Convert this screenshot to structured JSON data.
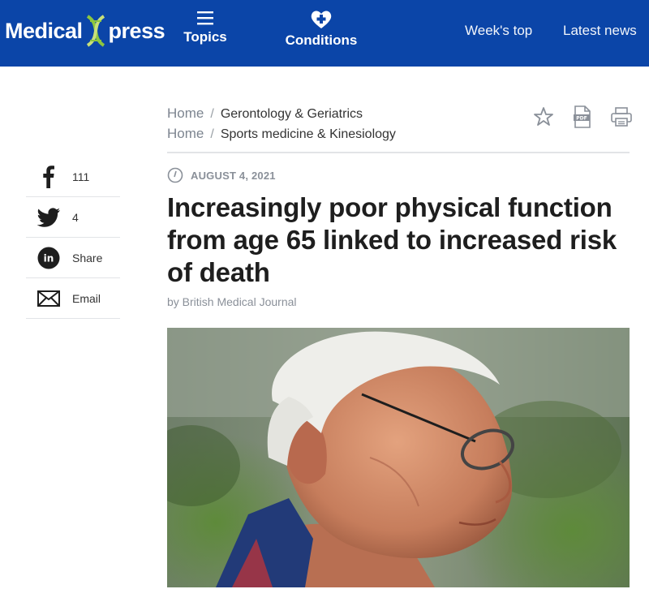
{
  "header": {
    "logo_left": "Medical",
    "logo_right": "press",
    "nav_topics": "Topics",
    "nav_conditions": "Conditions",
    "nav_weeks_top": "Week's top",
    "nav_latest_news": "Latest news",
    "bg_color": "#0b45a8"
  },
  "breadcrumbs": [
    {
      "home": "Home",
      "sep": "/",
      "category": "Gerontology & Geriatrics"
    },
    {
      "home": "Home",
      "sep": "/",
      "category": "Sports medicine & Kinesiology"
    }
  ],
  "tools": [
    "star-icon",
    "pdf-icon",
    "print-icon"
  ],
  "share": {
    "facebook_count": "111",
    "twitter_count": "4",
    "linkedin_label": "Share",
    "email_label": "Email"
  },
  "article": {
    "date": "AUGUST 4, 2021",
    "title": "Increasingly poor physical function from age 65 linked to increased risk of death",
    "byline": "by British Medical Journal"
  }
}
